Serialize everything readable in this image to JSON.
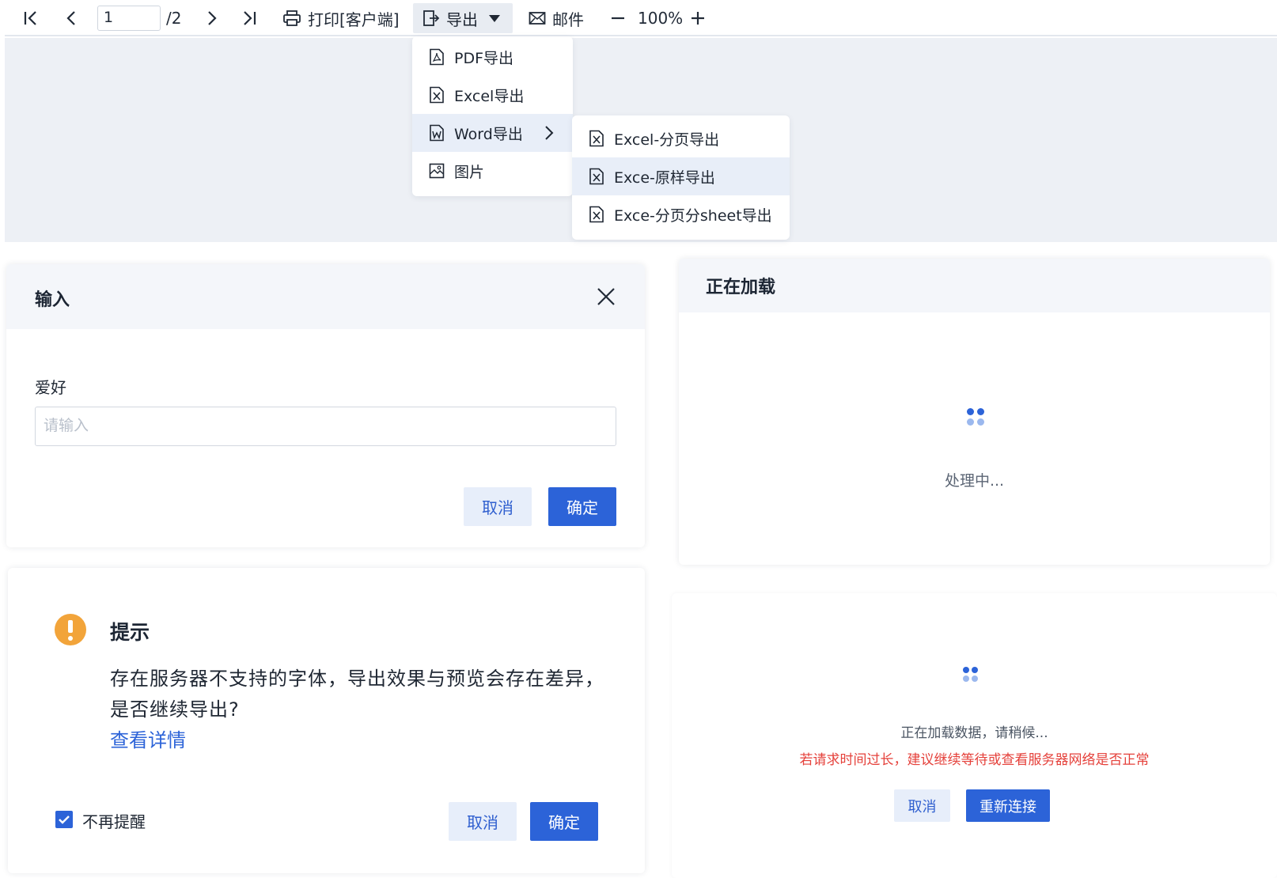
{
  "toolbar": {
    "page_current": "1",
    "page_total": "/2",
    "print_label": "打印[客户端]",
    "export_label": "导出",
    "mail_label": "邮件",
    "zoom_level": "100%"
  },
  "export_menu": {
    "items": [
      {
        "label": "PDF导出",
        "icon": "pdf-file-icon"
      },
      {
        "label": "Excel导出",
        "icon": "excel-file-icon"
      },
      {
        "label": "Word导出",
        "icon": "word-file-icon"
      },
      {
        "label": "图片",
        "icon": "image-icon"
      }
    ]
  },
  "word_submenu": {
    "items": [
      {
        "label": "Excel-分页导出",
        "icon": "excel-file-icon"
      },
      {
        "label": "Exce-原样导出",
        "icon": "excel-file-icon"
      },
      {
        "label": "Exce-分页分sheet导出",
        "icon": "excel-file-icon"
      }
    ]
  },
  "input_dialog": {
    "title": "输入",
    "field_label": "爱好",
    "placeholder": "请输入",
    "cancel_label": "取消",
    "confirm_label": "确定"
  },
  "loading_dialog": {
    "title": "正在加载",
    "status_text": "处理中..."
  },
  "hint_dialog": {
    "title": "提示",
    "message": "存在服务器不支持的字体，导出效果与预览会存在差异，是否继续导出?",
    "link_label": "查看详情",
    "checkbox_label": "不再提醒",
    "checkbox_checked": true,
    "cancel_label": "取消",
    "confirm_label": "确定"
  },
  "reconnect_panel": {
    "loading_text": "正在加载数据，请稍候...",
    "warning_text": "若请求时间过长，建议继续等待或查看服务器网络是否正常",
    "cancel_label": "取消",
    "reconnect_label": "重新连接"
  },
  "colors": {
    "primary": "#2c63d8",
    "warning": "#f2a43a",
    "error": "#e5413b",
    "canvas_bg": "#edf0f5"
  }
}
